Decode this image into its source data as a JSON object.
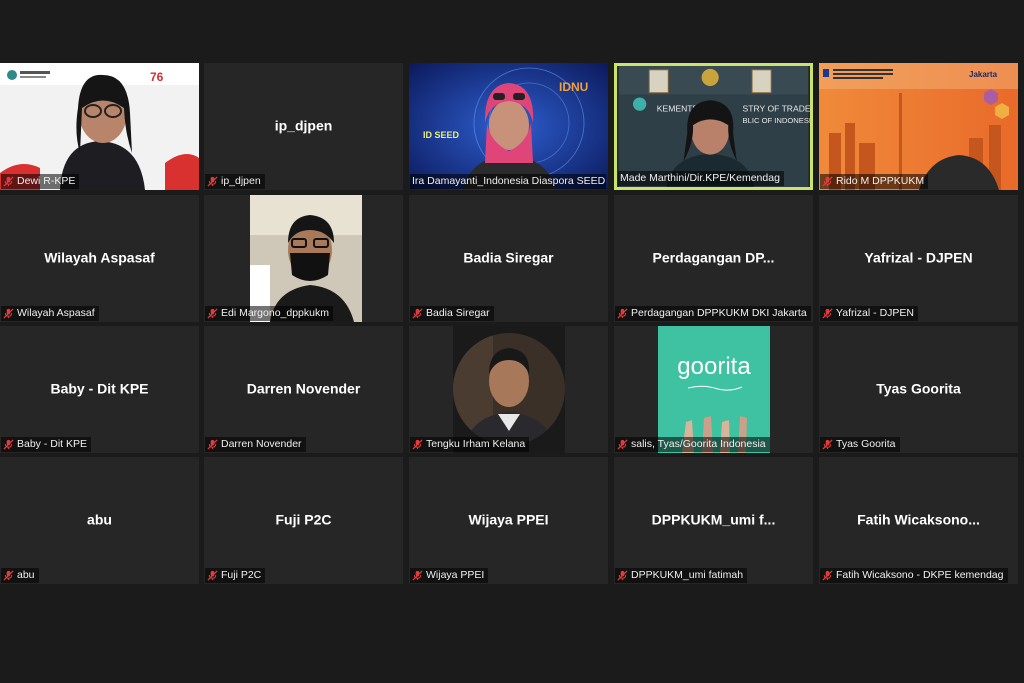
{
  "colors": {
    "background": "#1b1b1b",
    "tile": "#262626",
    "active_speaker_border": "#c9e46a",
    "muted_icon": "#e23b3b"
  },
  "participants": [
    {
      "name": "Dewi R-KPE",
      "display": "",
      "video": "webcam-dewi",
      "muted": true
    },
    {
      "name": "ip_djpen",
      "display": "ip_djpen",
      "video": "",
      "muted": true
    },
    {
      "name": "Ira Damayanti_Indonesia Diaspora SEED",
      "display": "",
      "video": "webcam-ira",
      "muted": false
    },
    {
      "name": "Made Marthini/Dir.KPE/Kemendag",
      "display": "",
      "video": "webcam-made",
      "muted": false,
      "active": true
    },
    {
      "name": "Rido M DPPKUKM",
      "display": "",
      "video": "webcam-rido",
      "muted": true
    },
    {
      "name": "Wilayah Aspasaf",
      "display": "Wilayah Aspasaf",
      "video": "",
      "muted": true
    },
    {
      "name": "Edi Margono_dppkukm",
      "display": "",
      "video": "webcam-edi",
      "muted": true
    },
    {
      "name": "Badia Siregar",
      "display": "Badia Siregar",
      "video": "",
      "muted": true
    },
    {
      "name": "Perdagangan DPPKUKM DKI Jakarta",
      "display": "Perdagangan  DP...",
      "video": "",
      "muted": true
    },
    {
      "name": "Yafrizal - DJPEN",
      "display": "Yafrizal - DJPEN",
      "video": "",
      "muted": true
    },
    {
      "name": "Baby - Dit KPE",
      "display": "Baby - Dit KPE",
      "video": "",
      "muted": true
    },
    {
      "name": "Darren Novender",
      "display": "Darren Novender",
      "video": "",
      "muted": true
    },
    {
      "name": "Tengku Irham Kelana",
      "display": "",
      "video": "photo-tengku",
      "muted": true
    },
    {
      "name": "salis, Tyas/Goorita Indonesia",
      "display": "",
      "video": "logo-goorita",
      "muted": true
    },
    {
      "name": "Tyas Goorita",
      "display": "Tyas Goorita",
      "video": "",
      "muted": true
    },
    {
      "name": "abu",
      "display": "abu",
      "video": "",
      "muted": true
    },
    {
      "name": "Fuji P2C",
      "display": "Fuji P2C",
      "video": "",
      "muted": true
    },
    {
      "name": "Wijaya PPEI",
      "display": "Wijaya PPEI",
      "video": "",
      "muted": true
    },
    {
      "name": "DPPKUKM_umi fatimah",
      "display": "DPPKUKM_umi  f...",
      "video": "",
      "muted": true
    },
    {
      "name": "Fatih Wicaksono - DKPE kemendag",
      "display": "Fatih  Wicaksono...",
      "video": "",
      "muted": true
    }
  ],
  "banners": {
    "goorita_logo": "goorita"
  }
}
